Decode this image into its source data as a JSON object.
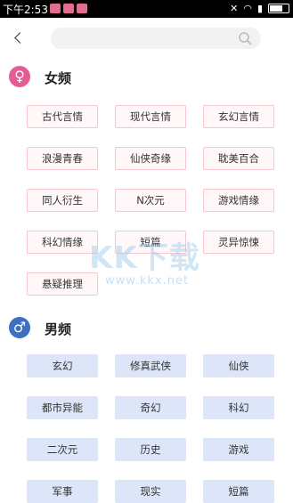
{
  "status_bar": {
    "time": "下午2:53"
  },
  "search": {
    "value": ""
  },
  "female": {
    "title": "女频",
    "icon": "female-icon",
    "tags": [
      "古代言情",
      "现代言情",
      "玄幻言情",
      "浪漫青春",
      "仙侠奇缘",
      "耽美百合",
      "同人衍生",
      "N次元",
      "游戏情缘",
      "科幻情缘",
      "短篇",
      "灵异惊悚",
      "悬疑推理"
    ]
  },
  "male": {
    "title": "男频",
    "icon": "male-icon",
    "tags": [
      "玄幻",
      "修真武侠",
      "仙侠",
      "都市异能",
      "奇幻",
      "科幻",
      "二次元",
      "历史",
      "游戏",
      "军事",
      "现实",
      "短篇"
    ]
  },
  "watermark": {
    "text": "KK下载",
    "url": "www.kkx.net"
  },
  "colors": {
    "female_accent": "#e45c91",
    "male_accent": "#3f6fc2",
    "female_tag_border": "#f7c5cd",
    "male_tag_bg": "#dde6f8"
  }
}
